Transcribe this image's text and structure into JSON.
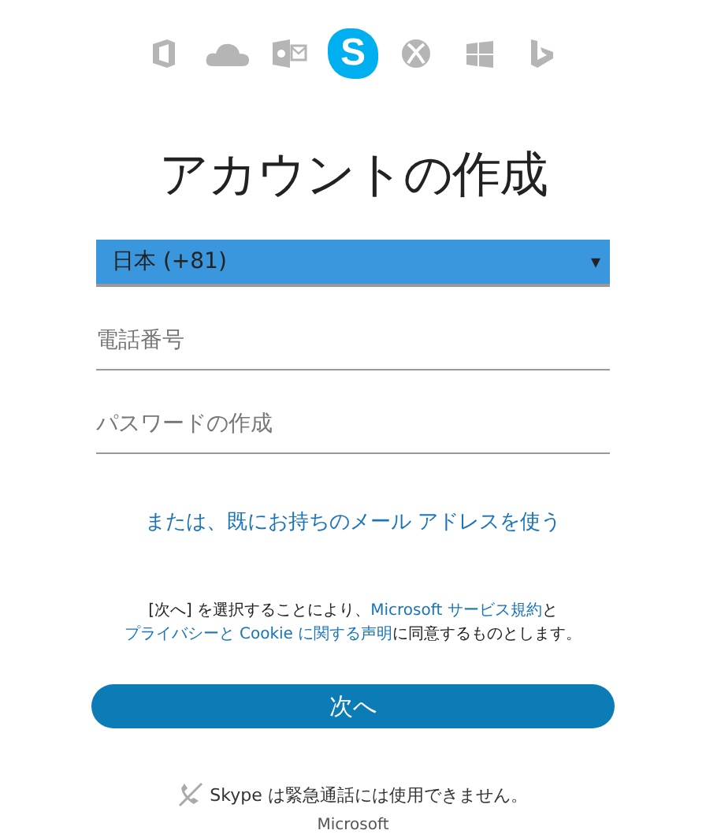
{
  "product_icons": [
    {
      "kind": "office",
      "selected": false
    },
    {
      "kind": "onedrive",
      "selected": false
    },
    {
      "kind": "outlook",
      "selected": false
    },
    {
      "kind": "skype",
      "selected": true,
      "letter": "S"
    },
    {
      "kind": "xbox",
      "selected": false
    },
    {
      "kind": "windows",
      "selected": false
    },
    {
      "kind": "bing",
      "selected": false
    }
  ],
  "title": "アカウントの作成",
  "country_select": {
    "value": "日本 (+81)",
    "arrow": "▾"
  },
  "phone_field": {
    "placeholder": "電話番号"
  },
  "password_field": {
    "placeholder": "パスワードの作成"
  },
  "email_link": "または、既にお持ちのメール アドレスを使う",
  "consent": [
    {
      "text": "[次へ] を選択することにより、",
      "link": false
    },
    {
      "text": "Microsoft サービス規約",
      "link": true
    },
    {
      "text": "と",
      "link": false
    },
    {
      "text": "プライバシーと Cookie に関する声明",
      "link": true
    },
    {
      "text": "に同意するものとします。",
      "link": false
    }
  ],
  "next_button": "次へ",
  "emergency_notice": "Skype は緊急通話には使用できません。",
  "footer": "Microsoft"
}
